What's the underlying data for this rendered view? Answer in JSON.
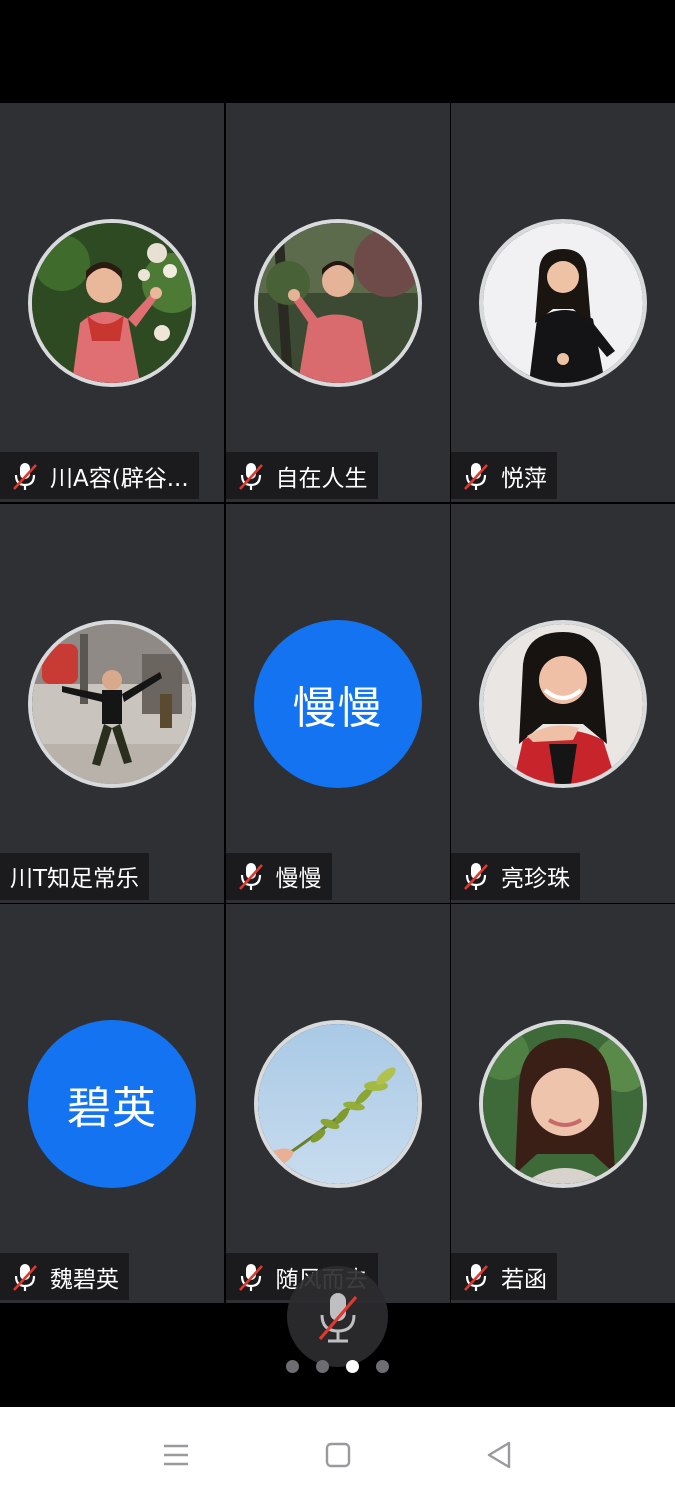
{
  "participants": [
    {
      "name": "川A容(辟谷...",
      "muted": true,
      "avatar": "photo-woman-pink-dress-green-background"
    },
    {
      "name": "自在人生",
      "muted": true,
      "avatar": "photo-woman-dancing-trees"
    },
    {
      "name": "悦萍",
      "muted": true,
      "avatar": "photo-woman-black-dress-white-background"
    },
    {
      "name": "川T知足常乐",
      "muted": false,
      "avatar": "photo-man-dancing-street"
    },
    {
      "name": "慢慢",
      "muted": true,
      "avatar_text": "慢慢"
    },
    {
      "name": "亮珍珠",
      "muted": true,
      "avatar": "photo-woman-red-jacket-selfie"
    },
    {
      "name": "魏碧英",
      "muted": true,
      "avatar_text": "碧英"
    },
    {
      "name": "随风而去",
      "muted": true,
      "avatar": "photo-hand-holding-leaf-sky"
    },
    {
      "name": "若函",
      "muted": true,
      "avatar": "photo-woman-portrait-greenery"
    }
  ],
  "mic_button": {
    "icon": "mic-off-icon"
  },
  "page_indicator": {
    "total": 4,
    "current": 3
  },
  "colors": {
    "tile": "#2f3033",
    "text_avatar": "#1473f0",
    "muted_slash": "#e0382e"
  },
  "nav": {
    "icons": [
      "menu-icon",
      "home-icon",
      "back-icon"
    ]
  }
}
